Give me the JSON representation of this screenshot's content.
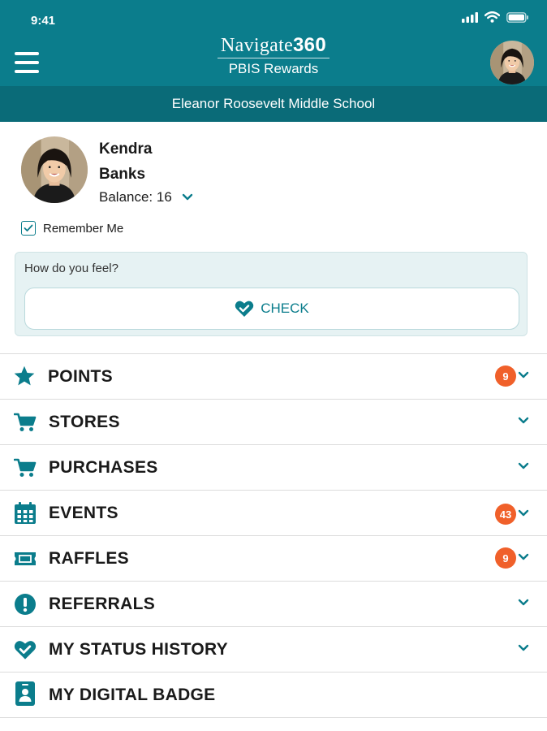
{
  "status_bar": {
    "time": "9:41"
  },
  "header": {
    "brand_main": "Navigate",
    "brand_num": "360",
    "brand_sub": "PBIS Rewards",
    "school": "Eleanor Roosevelt Middle School"
  },
  "profile": {
    "first_name": "Kendra",
    "last_name": "Banks",
    "balance_label": "Balance: 16",
    "remember_me": "Remember Me",
    "remember_checked": true
  },
  "feel": {
    "question": "How do you feel?",
    "button_label": "CHECK"
  },
  "menu": {
    "items": [
      {
        "label": "POINTS",
        "icon": "star-icon",
        "badge": "9",
        "chevron": true
      },
      {
        "label": "STORES",
        "icon": "cart-icon",
        "badge": "",
        "chevron": true
      },
      {
        "label": "PURCHASES",
        "icon": "cart-icon",
        "badge": "",
        "chevron": true
      },
      {
        "label": "EVENTS",
        "icon": "calendar-icon",
        "badge": "43",
        "chevron": true
      },
      {
        "label": "RAFFLES",
        "icon": "ticket-icon",
        "badge": "9",
        "chevron": true
      },
      {
        "label": "REFERRALS",
        "icon": "exclamation-icon",
        "badge": "",
        "chevron": true
      },
      {
        "label": "MY STATUS HISTORY",
        "icon": "heart-check-icon",
        "badge": "",
        "chevron": true
      },
      {
        "label": "MY DIGITAL BADGE",
        "icon": "id-badge-icon",
        "badge": "",
        "chevron": false
      }
    ]
  },
  "colors": {
    "primary": "#0b7d8c",
    "school_bar": "#0a6b78",
    "badge": "#f0602a",
    "card": "#e6f2f3"
  }
}
